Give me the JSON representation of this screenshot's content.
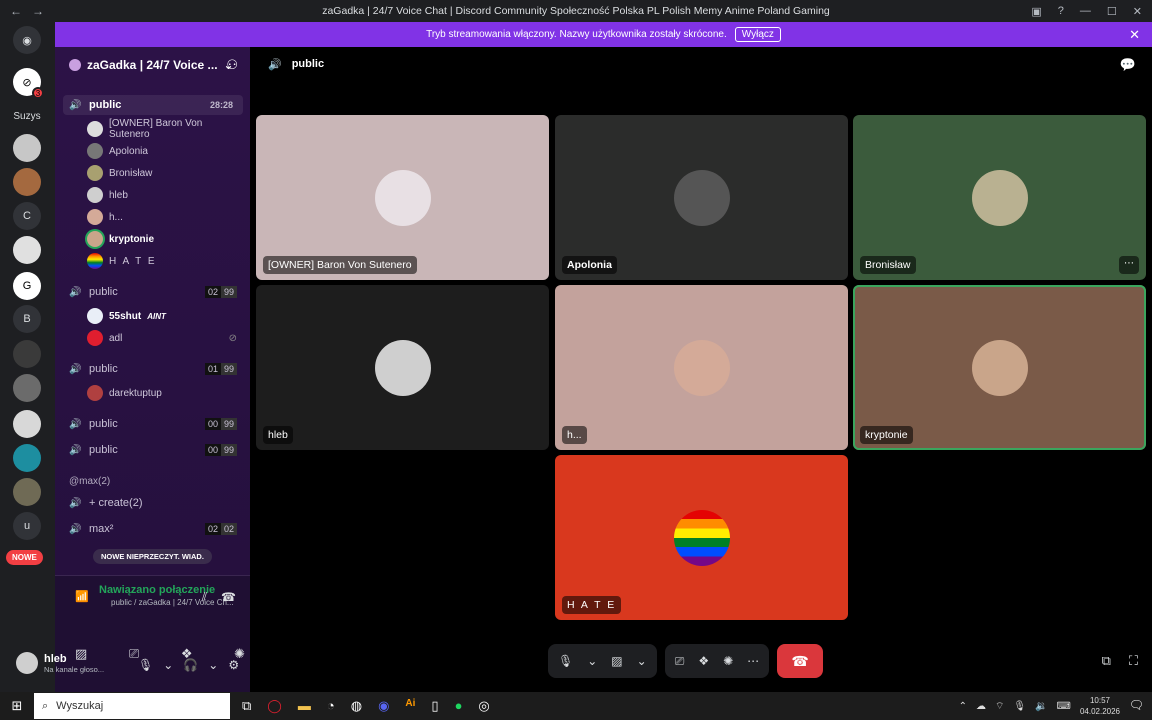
{
  "window": {
    "title": "zaGadka | 24/7 Voice Chat | Discord Community Społeczność Polska PL Polish Memy Anime Poland Gaming"
  },
  "banner": {
    "text": "Tryb streamowania włączony. Nazwy użytkownika zostały skrócone.",
    "button": "Wyłącz"
  },
  "rail": {
    "badge": "3",
    "labels": [
      "Suzys",
      "C",
      "B",
      "u"
    ],
    "new_label": "NOWE"
  },
  "guild": {
    "name": "zaGadka | 24/7 Voice ..."
  },
  "channels": {
    "active": {
      "name": "public",
      "time": "28:28"
    },
    "active_users": [
      "[OWNER] Baron Von Sutenero",
      "Apolonia",
      "Bronisław",
      "hleb",
      "h...",
      "kryptonie",
      "H A T E"
    ],
    "c2": {
      "name": "public",
      "count": "02",
      "limit": "99"
    },
    "c2_users": [
      "55shut",
      "adl"
    ],
    "c2_tag": "AINT",
    "c3": {
      "name": "public",
      "count": "01",
      "limit": "99"
    },
    "c3_users": [
      "darektuptup"
    ],
    "c4": {
      "name": "public",
      "count": "00",
      "limit": "99"
    },
    "c5": {
      "name": "public",
      "count": "00",
      "limit": "99"
    },
    "category": "@max(2)",
    "create": "+ create(2)",
    "max": {
      "name": "max²",
      "count": "02",
      "limit": "02"
    },
    "new_messages": "NOWE NIEPRZECZYT. WIAD."
  },
  "voice_panel": {
    "status": "Nawiązano połączenie",
    "channel": "public / zaGadka | 24/7 Voice Ch...",
    "username": "hleb",
    "user_state": "Na kanale głoso..."
  },
  "main": {
    "channel_name": "public",
    "tiles": [
      {
        "name": "[OWNER] Baron Von Sutenero",
        "bg": "#c9b6b7",
        "avatar": "#e8e0e4"
      },
      {
        "name": "Apolonia",
        "bg": "#2b2c2b",
        "avatar": "#555"
      },
      {
        "name": "Bronisław",
        "bg": "#3b5b3c",
        "avatar": "#b9b191"
      },
      {
        "name": "hleb",
        "bg": "#1d1d1d",
        "avatar": "#cfcfcf"
      },
      {
        "name": "h...",
        "bg": "#c3a29c",
        "avatar": "#d4aa98"
      },
      {
        "name": "kryptonie",
        "bg": "#7a5a48",
        "avatar": "#c9a58a"
      },
      {
        "name": "H A T E",
        "bg": "#d9381e",
        "avatar": "rainbow"
      }
    ]
  },
  "taskbar": {
    "search": "Wyszukaj",
    "time": "10:57",
    "date": "04.02.2026"
  }
}
